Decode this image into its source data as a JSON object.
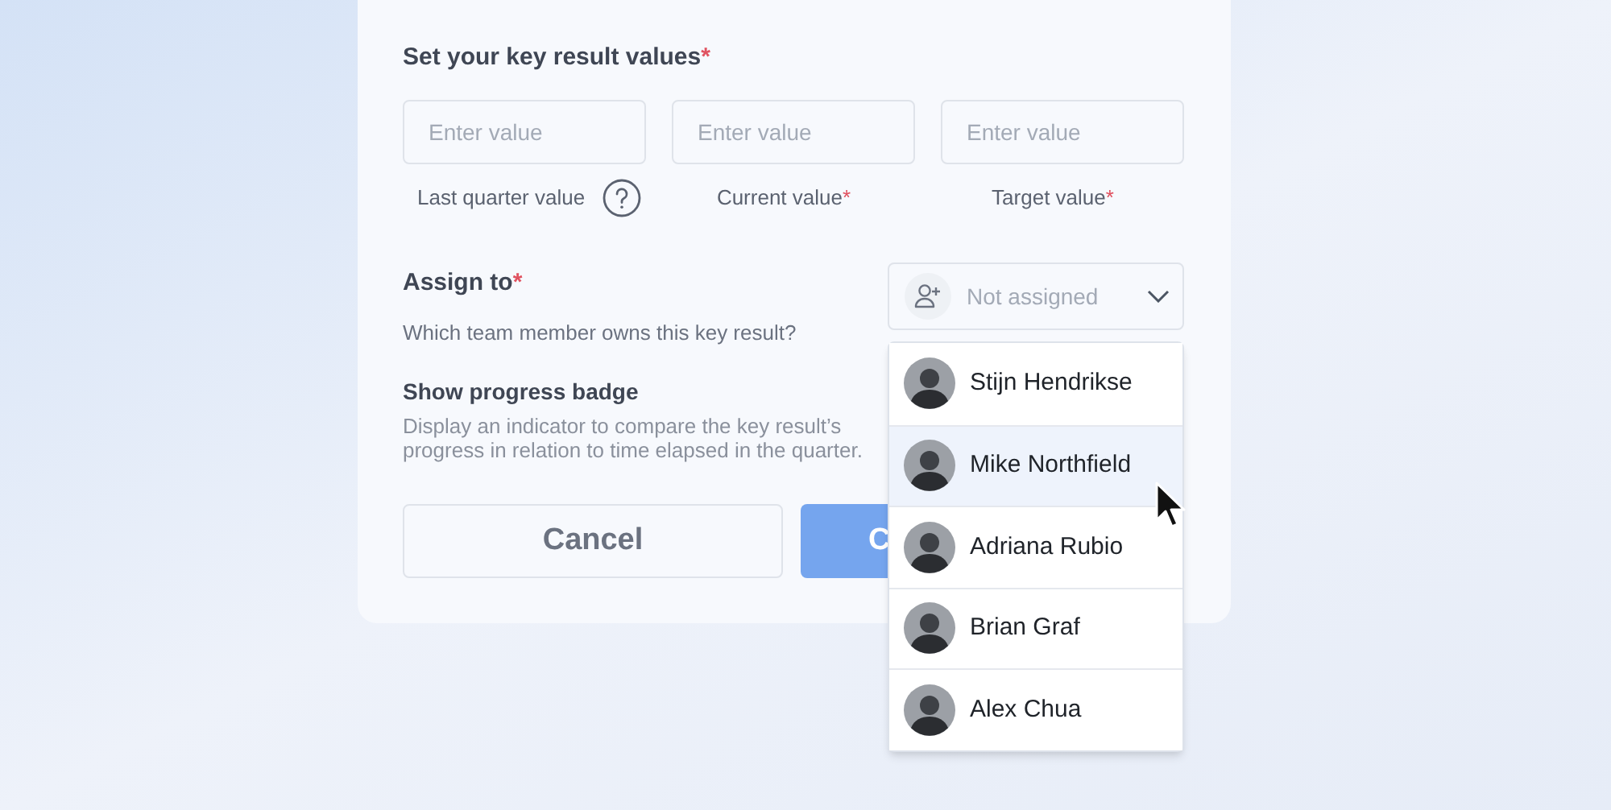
{
  "values_section": {
    "title": "Set your key result values",
    "required_mark": "*"
  },
  "value_fields": [
    {
      "placeholder": "Enter value",
      "label": "Last quarter value",
      "help": true
    },
    {
      "placeholder": "Enter value",
      "label": "Current value",
      "required_mark": "*"
    },
    {
      "placeholder": "Enter value",
      "label": "Target value",
      "required_mark": "*"
    }
  ],
  "assign": {
    "title": "Assign to",
    "required_mark": "*",
    "description": "Which team member owns this key result?",
    "select": {
      "placeholder": "Not assigned",
      "expanded": true
    }
  },
  "progress_badge": {
    "title": "Show progress badge",
    "description": "Display an indicator to compare the key result’s progress in relation to time elapsed in the quarter."
  },
  "buttons": [
    {
      "label": "Cancel",
      "kind": "secondary"
    },
    {
      "label": "C",
      "kind": "primary"
    }
  ],
  "members": [
    {
      "name": "Stijn Hendrikse",
      "selected": false
    },
    {
      "name": "Mike Northfield",
      "selected": true
    },
    {
      "name": "Adriana Rubio",
      "selected": false
    },
    {
      "name": "Brian Graf",
      "selected": false
    },
    {
      "name": "Alex Chua",
      "selected": false
    }
  ]
}
